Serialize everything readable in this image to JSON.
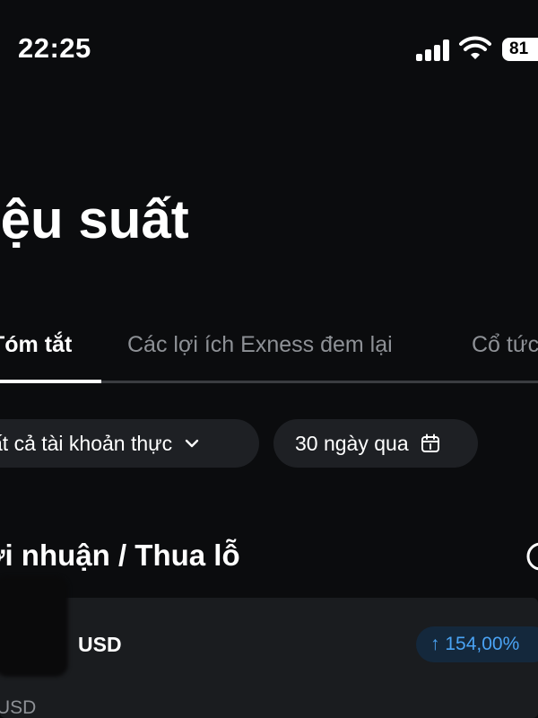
{
  "status_bar": {
    "time": "22:25",
    "battery": "81"
  },
  "header": {
    "title": "iệu suất"
  },
  "tabs": [
    {
      "label": "Tóm tắt",
      "active": true
    },
    {
      "label": "Các lợi ích Exness đem lại",
      "active": false
    },
    {
      "label": "Cổ tức",
      "active": false
    }
  ],
  "filters": {
    "accounts_label": "ất cả tài khoản thực",
    "period_label": "30 ngày qua"
  },
  "section": {
    "title": "ợi nhuận / Thua lỗ"
  },
  "card": {
    "currency": "USD",
    "change": "↑ 154,00%",
    "sub_currency": "USD"
  },
  "colors": {
    "background": "#0b0c0e",
    "card": "#1a1c1f",
    "accent": "#4aa3f4",
    "muted": "#8e9196"
  }
}
